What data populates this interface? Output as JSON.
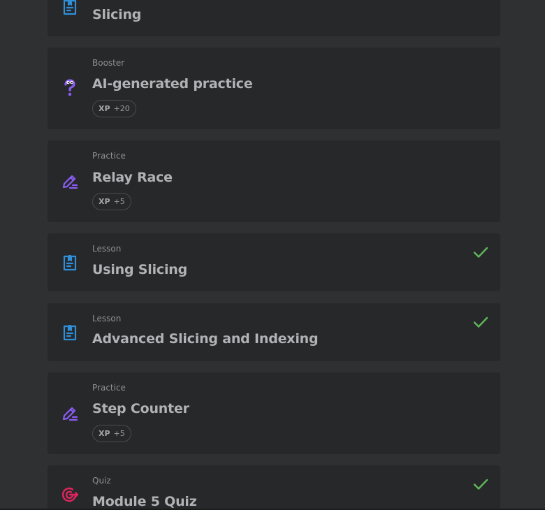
{
  "items": [
    {
      "type": "",
      "title": "Slicing",
      "xp": null,
      "completed": true,
      "icon": "lesson-icon"
    },
    {
      "type": "Booster",
      "title": "AI-generated practice",
      "xp": {
        "label": "XP",
        "value": "+20"
      },
      "completed": false,
      "icon": "ai-question-icon"
    },
    {
      "type": "Practice",
      "title": "Relay Race",
      "xp": {
        "label": "XP",
        "value": "+5"
      },
      "completed": false,
      "icon": "practice-pencil-icon"
    },
    {
      "type": "Lesson",
      "title": "Using Slicing",
      "xp": null,
      "completed": true,
      "icon": "lesson-icon"
    },
    {
      "type": "Lesson",
      "title": "Advanced Slicing and Indexing",
      "xp": null,
      "completed": true,
      "icon": "lesson-icon"
    },
    {
      "type": "Practice",
      "title": "Step Counter",
      "xp": {
        "label": "XP",
        "value": "+5"
      },
      "completed": false,
      "icon": "practice-pencil-icon"
    },
    {
      "type": "Quiz",
      "title": "Module 5 Quiz",
      "xp": null,
      "completed": true,
      "icon": "quiz-target-icon"
    }
  ],
  "colors": {
    "background": "#2f3032",
    "card": "#27282a",
    "lesson_icon": "#2f8fd8",
    "practice_icon": "#8b5cf6",
    "quiz_icon": "#e0245e",
    "check": "#5fb85a"
  }
}
